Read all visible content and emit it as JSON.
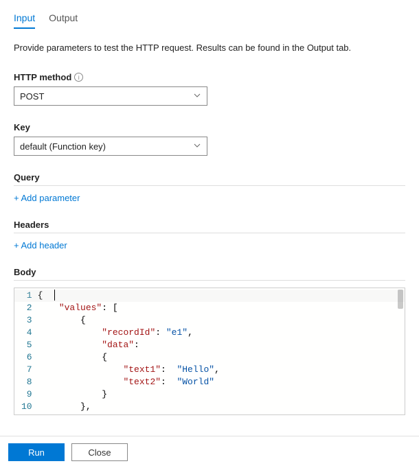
{
  "tabs": {
    "input": "Input",
    "output": "Output"
  },
  "description": "Provide parameters to test the HTTP request. Results can be found in the Output tab.",
  "httpMethod": {
    "label": "HTTP method",
    "value": "POST"
  },
  "key": {
    "label": "Key",
    "value": "default (Function key)"
  },
  "query": {
    "label": "Query",
    "addLabel": "+ Add parameter"
  },
  "headers": {
    "label": "Headers",
    "addLabel": "+ Add header"
  },
  "body": {
    "label": "Body",
    "lineNumbers": [
      "1",
      "2",
      "3",
      "4",
      "5",
      "6",
      "7",
      "8",
      "9",
      "10"
    ],
    "lines": [
      [
        {
          "t": "{",
          "c": "tok-pun"
        }
      ],
      [
        {
          "t": "    ",
          "c": "indent-guide"
        },
        {
          "t": "\"values\"",
          "c": "tok-str"
        },
        {
          "t": ": [",
          "c": "tok-pun"
        }
      ],
      [
        {
          "t": "        ",
          "c": "indent-guide"
        },
        {
          "t": "{",
          "c": "tok-pun"
        }
      ],
      [
        {
          "t": "            ",
          "c": "indent-guide"
        },
        {
          "t": "\"recordId\"",
          "c": "tok-str"
        },
        {
          "t": ": ",
          "c": "tok-pun"
        },
        {
          "t": "\"e1\"",
          "c": "tok-val"
        },
        {
          "t": ",",
          "c": "tok-pun"
        }
      ],
      [
        {
          "t": "            ",
          "c": "indent-guide"
        },
        {
          "t": "\"data\"",
          "c": "tok-str"
        },
        {
          "t": ":",
          "c": "tok-pun"
        }
      ],
      [
        {
          "t": "            ",
          "c": "indent-guide"
        },
        {
          "t": "{",
          "c": "tok-pun"
        }
      ],
      [
        {
          "t": "                ",
          "c": "indent-guide"
        },
        {
          "t": "\"text1\"",
          "c": "tok-str"
        },
        {
          "t": ":  ",
          "c": "tok-pun"
        },
        {
          "t": "\"Hello\"",
          "c": "tok-val"
        },
        {
          "t": ",",
          "c": "tok-pun"
        }
      ],
      [
        {
          "t": "                ",
          "c": "indent-guide"
        },
        {
          "t": "\"text2\"",
          "c": "tok-str"
        },
        {
          "t": ":  ",
          "c": "tok-pun"
        },
        {
          "t": "\"World\"",
          "c": "tok-val"
        }
      ],
      [
        {
          "t": "            ",
          "c": "indent-guide"
        },
        {
          "t": "}",
          "c": "tok-pun"
        }
      ],
      [
        {
          "t": "        ",
          "c": "indent-guide"
        },
        {
          "t": "},",
          "c": "tok-pun"
        }
      ]
    ]
  },
  "footer": {
    "run": "Run",
    "close": "Close"
  }
}
